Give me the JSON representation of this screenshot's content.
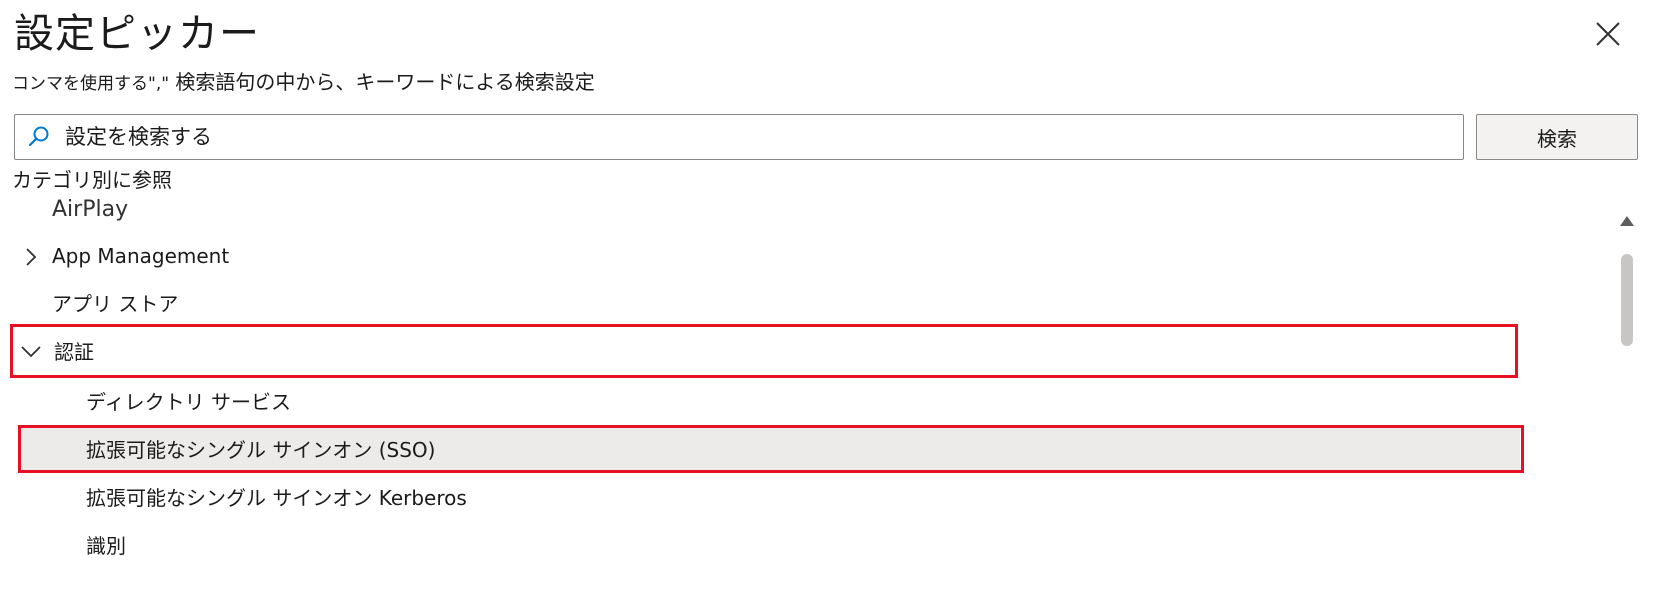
{
  "header": {
    "title": "設定ピッカー",
    "subtitle_small": "コンマを使用する\",\"",
    "subtitle_main": " 検索語句の中から、キーワードによる検索設定"
  },
  "search": {
    "placeholder": "設定を検索する",
    "button_label": "検索"
  },
  "browse": {
    "label": "カテゴリ別に参照"
  },
  "tree": {
    "items": [
      {
        "label": "AirPlay",
        "expandable": false,
        "expanded": false,
        "level": 0
      },
      {
        "label": "App Management",
        "expandable": true,
        "expanded": false,
        "level": 0
      },
      {
        "label": "アプリ ストア",
        "expandable": false,
        "expanded": false,
        "level": 0
      },
      {
        "label": "認証",
        "expandable": true,
        "expanded": true,
        "level": 0,
        "highlighted": true
      },
      {
        "label": "ディレクトリ サービス",
        "expandable": false,
        "expanded": false,
        "level": 1
      },
      {
        "label": "拡張可能なシングル サインオン (SSO)",
        "expandable": false,
        "expanded": false,
        "level": 1,
        "selected": true,
        "highlighted": true
      },
      {
        "label": "拡張可能なシングル サインオン Kerberos",
        "expandable": false,
        "expanded": false,
        "level": 1
      },
      {
        "label": "識別",
        "expandable": false,
        "expanded": false,
        "level": 1
      }
    ]
  },
  "icons": {
    "close": "close-icon",
    "search": "search-icon",
    "collapsed": "chevron-right-icon",
    "expanded": "chevron-down-icon",
    "scroll_up": "scroll-up-arrow-icon"
  },
  "colors": {
    "highlight": "#e81123",
    "selected_background": "#edebe9",
    "text": "#1b1b1b"
  }
}
